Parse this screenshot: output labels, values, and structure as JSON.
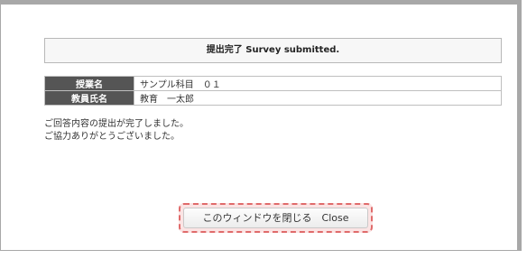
{
  "banner": {
    "text": "提出完了 Survey submitted."
  },
  "info_table": {
    "rows": [
      {
        "label": "授業名",
        "value": "サンプル科目　０１"
      },
      {
        "label": "教員氏名",
        "value": "教育　一太郎"
      }
    ]
  },
  "message": {
    "line1": "ご回答内容の提出が完了しました。",
    "line2": "ご協力ありがとうございました。"
  },
  "close_button": {
    "label": "このウィンドウを閉じる　Close"
  }
}
